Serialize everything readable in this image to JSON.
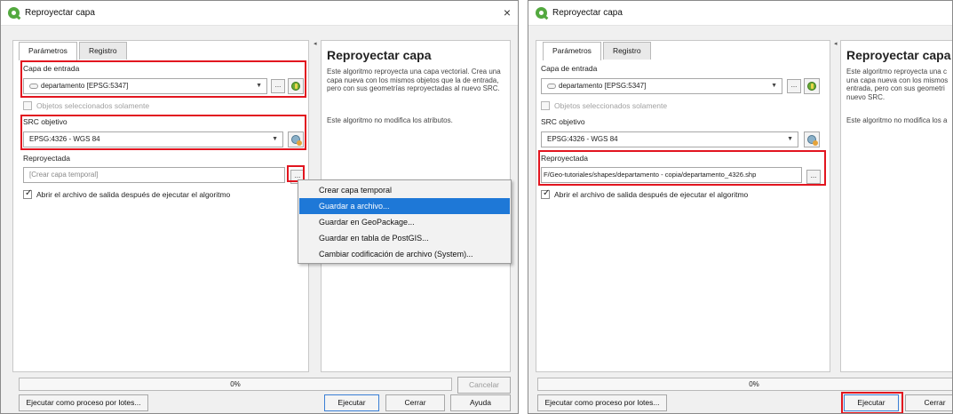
{
  "left": {
    "title": "Reproyectar capa",
    "close_glyph": "×",
    "tabs": [
      "Parámetros",
      "Registro"
    ],
    "input_layer": {
      "label": "Capa de entrada",
      "value": "departamento [EPSG:5347]"
    },
    "selected_only": "Objetos seleccionados solamente",
    "target_crs": {
      "label": "SRC objetivo",
      "value": "EPSG:4326 - WGS 84"
    },
    "output": {
      "label": "Reproyectada",
      "placeholder": "[Crear capa temporal]"
    },
    "open_after": "Abrir el archivo de salida después de ejecutar el algoritmo",
    "menu": {
      "items": [
        "Crear capa temporal",
        "Guardar a archivo...",
        "Guardar en GeoPackage...",
        "Guardar en tabla de PostGIS...",
        "Cambiar codificación de archivo (System)..."
      ],
      "highlighted_index": 1
    },
    "help": {
      "title": "Reproyectar capa",
      "text": "Este algoritmo reproyecta una capa vectorial. Crea una capa nueva con los mismos objetos que la de entrada, pero con sus geometrías reproyectadas al nuevo SRC.",
      "text2": "Este algoritmo no modifica los atributos."
    },
    "progress": "0%",
    "buttons": {
      "cancel": "Cancelar",
      "batch": "Ejecutar como proceso por lotes...",
      "run": "Ejecutar",
      "close": "Cerrar",
      "help": "Ayuda"
    },
    "ellipsis": "..."
  },
  "right": {
    "title": "Reproyectar capa",
    "tabs": [
      "Parámetros",
      "Registro"
    ],
    "input_layer": {
      "label": "Capa de entrada",
      "value": "departamento [EPSG:5347]"
    },
    "selected_only": "Objetos seleccionados solamente",
    "target_crs": {
      "label": "SRC objetivo",
      "value": "EPSG:4326 - WGS 84"
    },
    "output": {
      "label": "Reproyectada",
      "value": "F/Geo-tutoriales/shapes/departamento - copia/departamento_4326.shp"
    },
    "open_after": "Abrir el archivo de salida después de ejecutar el algoritmo",
    "help": {
      "title": "Reproyectar capa",
      "line1": "Este algoritmo reproyecta una c",
      "line2": "una capa nueva con los mismos",
      "line3": "entrada, pero con sus geometri",
      "line4": "nuevo SRC.",
      "text2": "Este algoritmo no modifica los a"
    },
    "progress": "0%",
    "buttons": {
      "batch": "Ejecutar como proceso por lotes...",
      "run": "Ejecutar",
      "close": "Cerrar"
    },
    "ellipsis": "..."
  },
  "colors": {
    "highlight_box": "#e2151f",
    "menu_highlight": "#1e78d7",
    "qgis_green": "#53a93f"
  }
}
